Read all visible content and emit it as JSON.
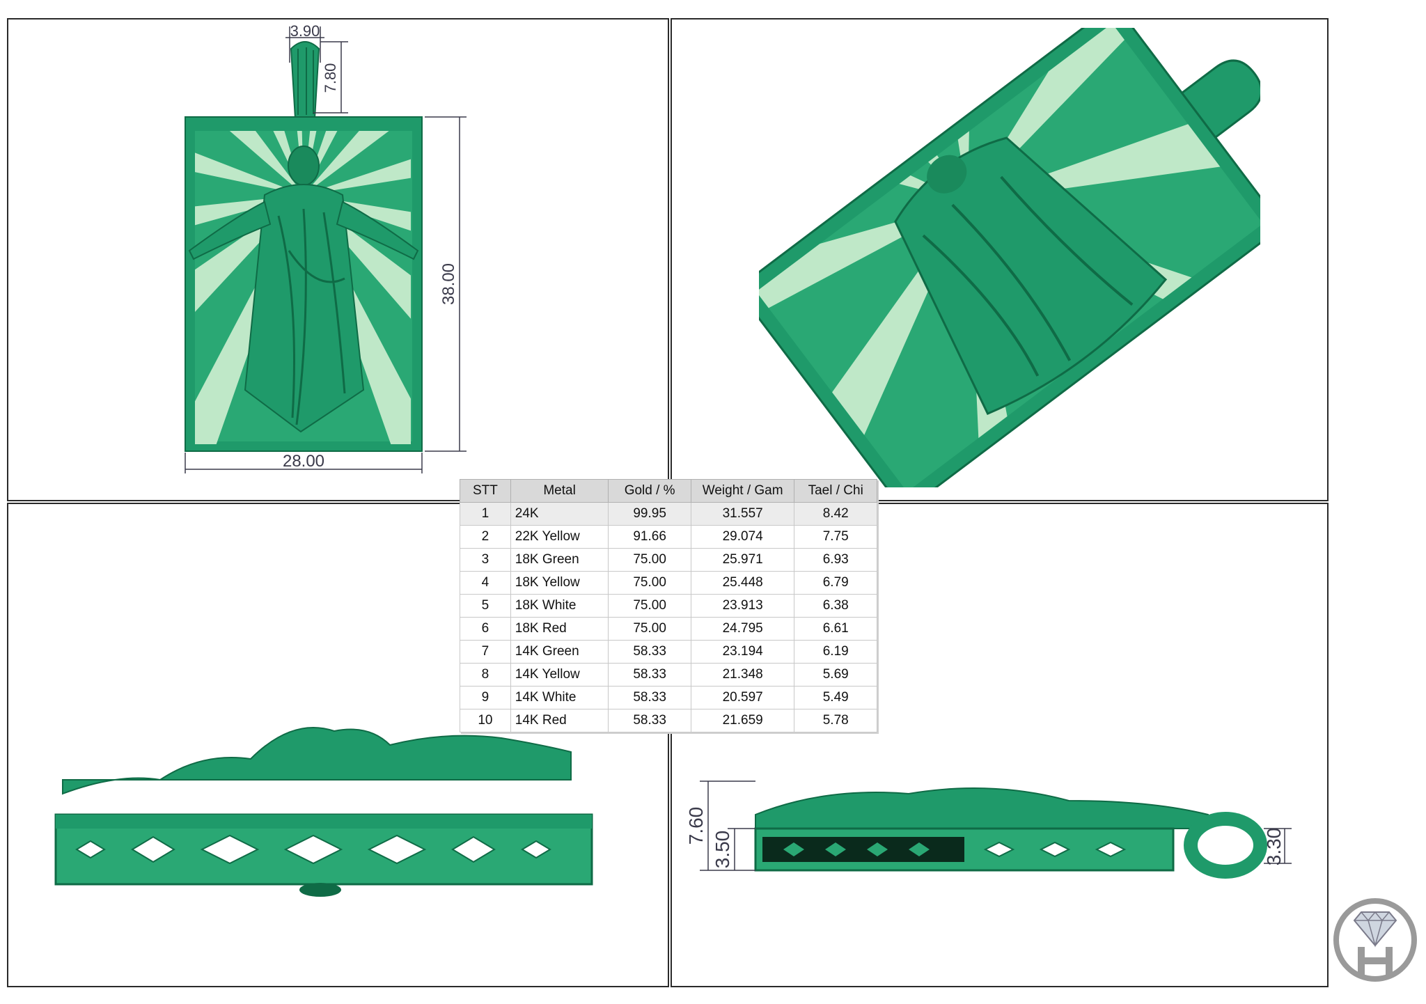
{
  "views": {
    "front": {
      "dims": {
        "bail_width": "3.90",
        "bail_height": "7.80",
        "height": "38.00",
        "width": "28.00"
      }
    },
    "side_right": {
      "dims": {
        "total_depth": "7.60",
        "frame_depth": "3.50",
        "bail_depth": "3.30"
      }
    }
  },
  "table": {
    "headers": [
      "STT",
      "Metal",
      "Gold / %",
      "Weight / Gam",
      "Tael / Chi"
    ],
    "rows": [
      [
        "1",
        "24K",
        "99.95",
        "31.557",
        "8.42"
      ],
      [
        "2",
        "22K Yellow",
        "91.66",
        "29.074",
        "7.75"
      ],
      [
        "3",
        "18K Green",
        "75.00",
        "25.971",
        "6.93"
      ],
      [
        "4",
        "18K Yellow",
        "75.00",
        "25.448",
        "6.79"
      ],
      [
        "5",
        "18K White",
        "75.00",
        "23.913",
        "6.38"
      ],
      [
        "6",
        "18K Red",
        "75.00",
        "24.795",
        "6.61"
      ],
      [
        "7",
        "14K Green",
        "58.33",
        "23.194",
        "6.19"
      ],
      [
        "8",
        "14K Yellow",
        "58.33",
        "21.348",
        "5.69"
      ],
      [
        "9",
        "14K White",
        "58.33",
        "20.597",
        "5.49"
      ],
      [
        "10",
        "14K Red",
        "58.33",
        "21.659",
        "5.78"
      ]
    ]
  },
  "colors": {
    "model_green": "#1f9a6a",
    "model_dark": "#0f6b46",
    "ray_light": "#bfe8c8",
    "dim_line": "#3a3a4a"
  },
  "logo": {
    "icon": "diamond-logo-icon"
  }
}
